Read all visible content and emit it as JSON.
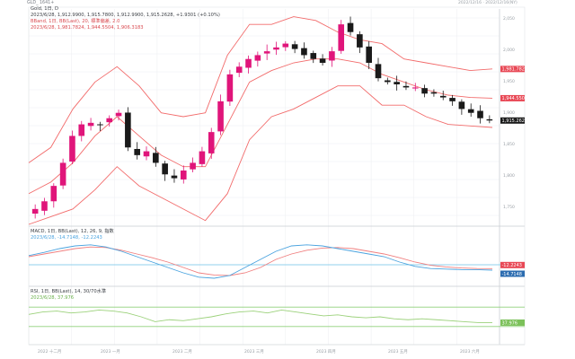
{
  "header": {
    "ticker": "GLD_ 1641+",
    "corner_date": "2022/12/16 · 2022/12/16(NY)"
  },
  "main_info": {
    "line1": "Gold, 1日, D",
    "line2": "2023/6/28, 1,912.9900, 1,915.7800, 1,912.9900, 1,915.2628, +1.9301 (+0.10%)",
    "line3": "BBand, 1日, BB(Last), 20, 標準偏差, 2.0",
    "line4": "2023/6/28, 1,981.7824, 1,944.5504, 1,906.3183"
  },
  "macd_info": {
    "line1": "MACD, 1日, BB(Last), 12, 26, 9, 指数",
    "line2": "2023/6/28, -14.7148, -12.2243"
  },
  "rsi_info": {
    "line1": "RSI, 1日, BB(Last), 14, 30/70水準",
    "line2": "2023/6/28, 37.976"
  },
  "price_tags": {
    "upper": "1,981.7824",
    "middle": "1,944.5504",
    "last": "1,915.2628"
  },
  "macd_tags": {
    "signal": "-12.2243",
    "macd": "-14.7148"
  },
  "rsi_tag": "37.976",
  "colors": {
    "up": "#e0157a",
    "down": "#1a1a1a",
    "band": "#f26b6b",
    "macd": "#4aa3df",
    "signal": "#f07f7f",
    "rsi": "#9bd17a",
    "hline": "#6cc3e8",
    "rsi_level": "#8fd07a",
    "grid": "#eceef1",
    "axis_text": "#9aa0a6"
  },
  "x_labels": [
    "2022 十二月",
    "2023 一月",
    "2023 二月",
    "2023 三月",
    "2023 四月",
    "2023 五月",
    "2023 六月"
  ],
  "y_labels": [
    "2,050",
    "2,000",
    "1,950",
    "1,900",
    "1,850",
    "1,800",
    "1,750"
  ],
  "chart_data": [
    {
      "type": "candlestick",
      "title": "Gold, 1日, D",
      "x": [
        "2022-12-01",
        "2023-06-28"
      ],
      "ylim": [
        1780,
        2060
      ],
      "series": [
        {
          "name": "BBand",
          "upper": [
            1860,
            1880,
            1930,
            1965,
            1985,
            1960,
            1925,
            1920,
            1925,
            2000,
            2040,
            2040,
            2050,
            2045,
            2030,
            2020,
            2015,
            1995,
            1990,
            1985,
            1980,
            1982
          ],
          "middle": [
            1820,
            1835,
            1860,
            1895,
            1920,
            1895,
            1870,
            1855,
            1855,
            1910,
            1965,
            1980,
            1990,
            1995,
            1995,
            1990,
            1975,
            1965,
            1955,
            1948,
            1945,
            1944
          ],
          "lower": [
            1780,
            1790,
            1800,
            1825,
            1855,
            1830,
            1815,
            1800,
            1785,
            1820,
            1890,
            1920,
            1930,
            1945,
            1960,
            1960,
            1935,
            1935,
            1920,
            1910,
            1908,
            1906
          ]
        }
      ],
      "close": [
        1800,
        1810,
        1830,
        1860,
        1895,
        1910,
        1912,
        1910,
        1918,
        1925,
        1880,
        1870,
        1875,
        1860,
        1845,
        1840,
        1850,
        1860,
        1875,
        1900,
        1940,
        1975,
        1985,
        1995,
        2000,
        2005,
        2010,
        2015,
        2008,
        2000,
        1995,
        1990,
        2005,
        2040,
        2030,
        2010,
        1990,
        1970,
        1965,
        1962,
        1958,
        1958,
        1950,
        1950,
        1945,
        1940,
        1930,
        1925,
        1918,
        1915
      ]
    },
    {
      "type": "line",
      "title": "MACD, 1日, BB(Last), 12, 26, 9, 指数",
      "ylim": [
        -40,
        40
      ],
      "series": [
        {
          "name": "MACD",
          "values": [
            12,
            18,
            25,
            30,
            32,
            28,
            20,
            10,
            0,
            -10,
            -20,
            -28,
            -30,
            -25,
            -10,
            5,
            20,
            30,
            32,
            30,
            25,
            20,
            15,
            10,
            0,
            -8,
            -12,
            -13,
            -14,
            -14,
            -15
          ]
        },
        {
          "name": "Signal",
          "values": [
            10,
            15,
            20,
            25,
            28,
            27,
            22,
            15,
            8,
            0,
            -10,
            -20,
            -24,
            -25,
            -20,
            -10,
            5,
            15,
            22,
            26,
            27,
            25,
            20,
            15,
            8,
            0,
            -6,
            -9,
            -11,
            -12,
            -12.2
          ]
        }
      ],
      "hline": -5
    },
    {
      "type": "line",
      "title": "RSI, 1日, BB(Last), 14, 30/70水準",
      "ylim": [
        0,
        100
      ],
      "series": [
        {
          "name": "RSI",
          "values": [
            55,
            60,
            62,
            58,
            60,
            64,
            62,
            58,
            50,
            40,
            44,
            42,
            46,
            50,
            56,
            60,
            62,
            58,
            64,
            60,
            56,
            52,
            54,
            50,
            48,
            50,
            46,
            44,
            46,
            44,
            42,
            40,
            38,
            38
          ]
        }
      ],
      "levels": [
        70,
        30
      ]
    }
  ]
}
